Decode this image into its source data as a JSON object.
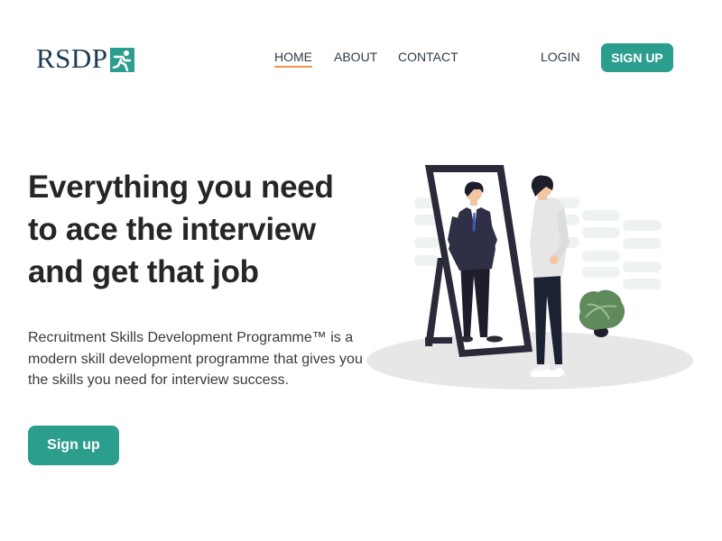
{
  "header": {
    "logo_text": "RSDP",
    "logo_icon": "figure-on-teal-square",
    "nav": [
      {
        "label": "HOME",
        "active": true
      },
      {
        "label": "ABOUT",
        "active": false
      },
      {
        "label": "CONTACT",
        "active": false
      }
    ],
    "login_label": "LOGIN",
    "signup_label": "SIGN UP"
  },
  "hero": {
    "headline_lines": [
      "Everything you need",
      "to ace the interview",
      "and get that job"
    ],
    "description": "Recruitment Skills Development Programme™ is a modern skill development programme that gives you the skills you need for interview success.",
    "cta_label": "Sign up"
  },
  "illustration": {
    "icon": "man-looking-in-mirror-illustration"
  },
  "colors": {
    "accent": "#2c9e8e",
    "nav_underline": "#f0944a",
    "logo_text": "#1f3a52",
    "headline": "#262626"
  }
}
